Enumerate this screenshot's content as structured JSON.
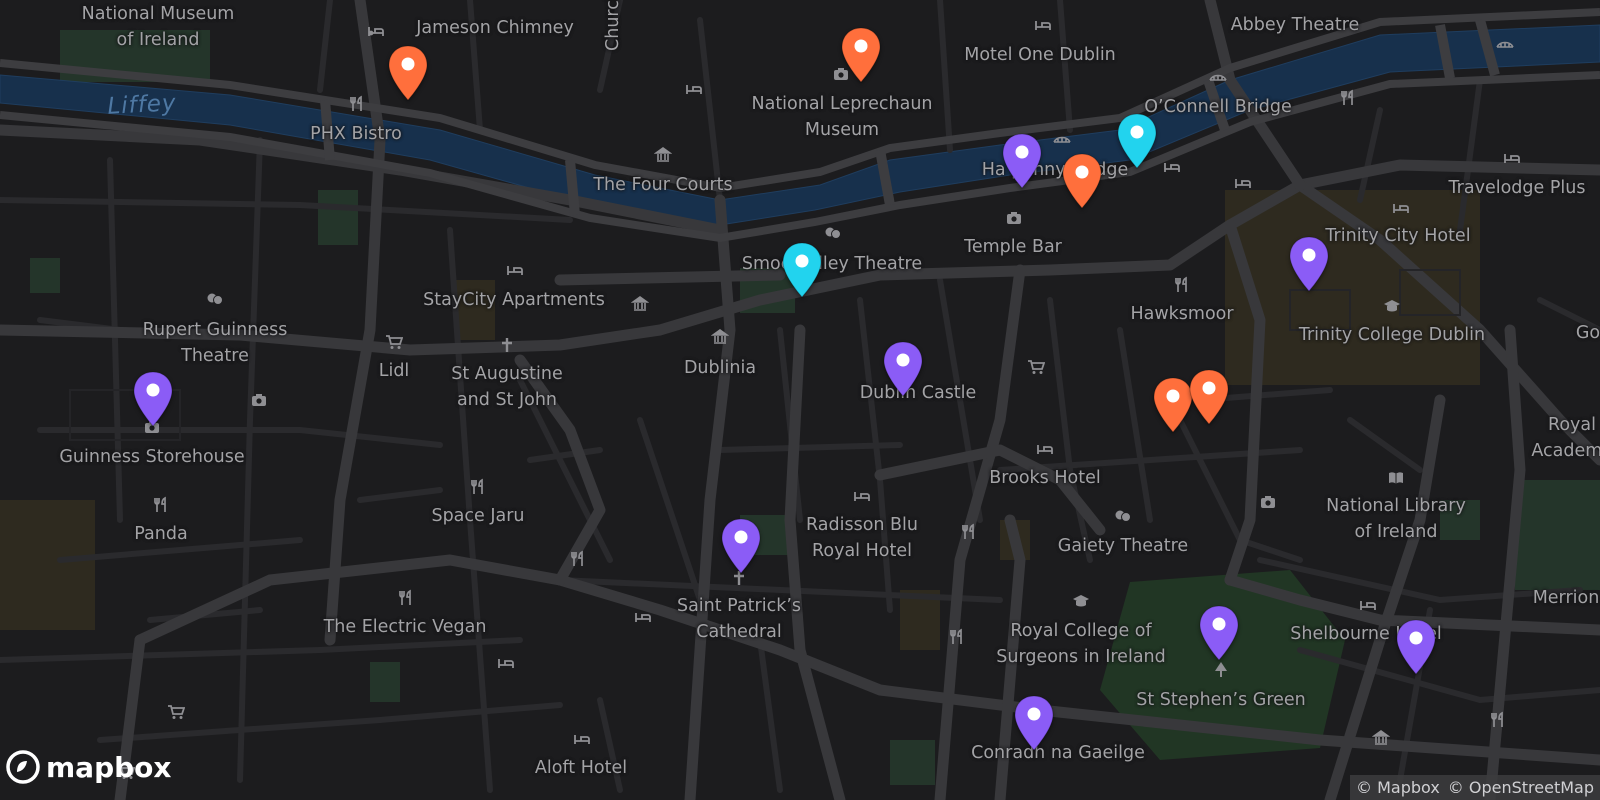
{
  "map": {
    "water_label": "Liffey",
    "place_labels": [
      {
        "id": "national-museum",
        "text": "National Museum\nof Ireland"
      },
      {
        "id": "jameson-chimney",
        "text": "Jameson Chimney"
      },
      {
        "id": "church",
        "text": "Church"
      },
      {
        "id": "abbey-theatre",
        "text": "Abbey Theatre"
      },
      {
        "id": "motel-one",
        "text": "Motel One Dublin"
      },
      {
        "id": "leprechaun-museum",
        "text": "National Leprechaun\nMuseum"
      },
      {
        "id": "oconnell-bridge",
        "text": "O’Connell Bridge"
      },
      {
        "id": "phx-bistro",
        "text": "PHX Bistro"
      },
      {
        "id": "four-courts",
        "text": "The Four Courts"
      },
      {
        "id": "hapenny-bridge",
        "text": "Ha’penny Bridge"
      },
      {
        "id": "travelodge",
        "text": "Travelodge Plus"
      },
      {
        "id": "temple-bar",
        "text": "Temple Bar"
      },
      {
        "id": "trinity-city-hotel",
        "text": "Trinity City Hotel"
      },
      {
        "id": "smock-alley",
        "text": "Smock Alley Theatre"
      },
      {
        "id": "staycity",
        "text": "StayCity Apartments"
      },
      {
        "id": "rupert-guinness",
        "text": "Rupert Guinness\nTheatre"
      },
      {
        "id": "hawksmoor",
        "text": "Hawksmoor"
      },
      {
        "id": "trinity-college",
        "text": "Trinity College Dublin"
      },
      {
        "id": "lidl",
        "text": "Lidl"
      },
      {
        "id": "st-augustine",
        "text": "St Augustine\nand St John"
      },
      {
        "id": "dublinia",
        "text": "Dublinia"
      },
      {
        "id": "dublin-castle",
        "text": "Dublin Castle"
      },
      {
        "id": "royal-academy",
        "text": "Royal\nAcademy"
      },
      {
        "id": "guinness-storehouse",
        "text": "Guinness Storehouse"
      },
      {
        "id": "brooks-hotel",
        "text": "Brooks Hotel"
      },
      {
        "id": "national-library",
        "text": "National Library\nof Ireland"
      },
      {
        "id": "space-jaru",
        "text": "Space Jaru"
      },
      {
        "id": "radisson",
        "text": "Radisson Blu\nRoyal Hotel"
      },
      {
        "id": "gaiety",
        "text": "Gaiety Theatre"
      },
      {
        "id": "panda",
        "text": "Panda"
      },
      {
        "id": "merrion",
        "text": "Merrion"
      },
      {
        "id": "st-patricks",
        "text": "Saint Patrick’s\nCathedral"
      },
      {
        "id": "electric-vegan",
        "text": "The Electric Vegan"
      },
      {
        "id": "rcsi",
        "text": "Royal College of\nSurgeons in Ireland"
      },
      {
        "id": "shelbourne",
        "text": "Shelbourne Hotel"
      },
      {
        "id": "st-stephens-green",
        "text": "St Stephen’s Green"
      },
      {
        "id": "conradh",
        "text": "Conradh na Gaeilge"
      },
      {
        "id": "aloft",
        "text": "Aloft Hotel"
      },
      {
        "id": "go",
        "text": "Go"
      }
    ],
    "poi_icons": [
      {
        "id": "hotel",
        "icon": "bed-icon"
      },
      {
        "id": "restaurant",
        "icon": "fork-knife-icon"
      },
      {
        "id": "museum",
        "icon": "museum-icon"
      },
      {
        "id": "theatre",
        "icon": "theatre-masks-icon"
      },
      {
        "id": "camera",
        "icon": "camera-icon"
      },
      {
        "id": "shop",
        "icon": "shopping-cart-icon"
      },
      {
        "id": "church",
        "icon": "cross-icon"
      },
      {
        "id": "school",
        "icon": "graduation-cap-icon"
      },
      {
        "id": "library",
        "icon": "book-icon"
      },
      {
        "id": "park",
        "icon": "tree-icon"
      },
      {
        "id": "bridge",
        "icon": "bridge-icon"
      }
    ],
    "markers": [
      {
        "id": "m1",
        "color": "#ff6f3c",
        "category": "orange"
      },
      {
        "id": "m2",
        "color": "#ff6f3c",
        "category": "orange"
      },
      {
        "id": "m3",
        "color": "#8b5cf6",
        "category": "purple"
      },
      {
        "id": "m4",
        "color": "#ff6f3c",
        "category": "orange"
      },
      {
        "id": "m5",
        "color": "#22d3ee",
        "category": "cyan"
      },
      {
        "id": "m6",
        "color": "#22d3ee",
        "category": "cyan"
      },
      {
        "id": "m7",
        "color": "#8b5cf6",
        "category": "purple"
      },
      {
        "id": "m8",
        "color": "#8b5cf6",
        "category": "purple"
      },
      {
        "id": "m9",
        "color": "#ff6f3c",
        "category": "orange"
      },
      {
        "id": "m10",
        "color": "#ff6f3c",
        "category": "orange"
      },
      {
        "id": "m11",
        "color": "#8b5cf6",
        "category": "purple"
      },
      {
        "id": "m12",
        "color": "#8b5cf6",
        "category": "purple"
      },
      {
        "id": "m13",
        "color": "#8b5cf6",
        "category": "purple"
      },
      {
        "id": "m14",
        "color": "#8b5cf6",
        "category": "purple"
      },
      {
        "id": "m15",
        "color": "#8b5cf6",
        "category": "purple"
      }
    ]
  },
  "logo": {
    "text": "mapbox"
  },
  "attribution": {
    "mapbox": "© Mapbox",
    "osm": "© OpenStreetMap"
  },
  "colors": {
    "background": "#1c1c1e",
    "road": "#2e2e31",
    "major_road": "#3a3a3d",
    "water": "#173454",
    "park": "#253b27",
    "label": "#a3a3a6"
  }
}
